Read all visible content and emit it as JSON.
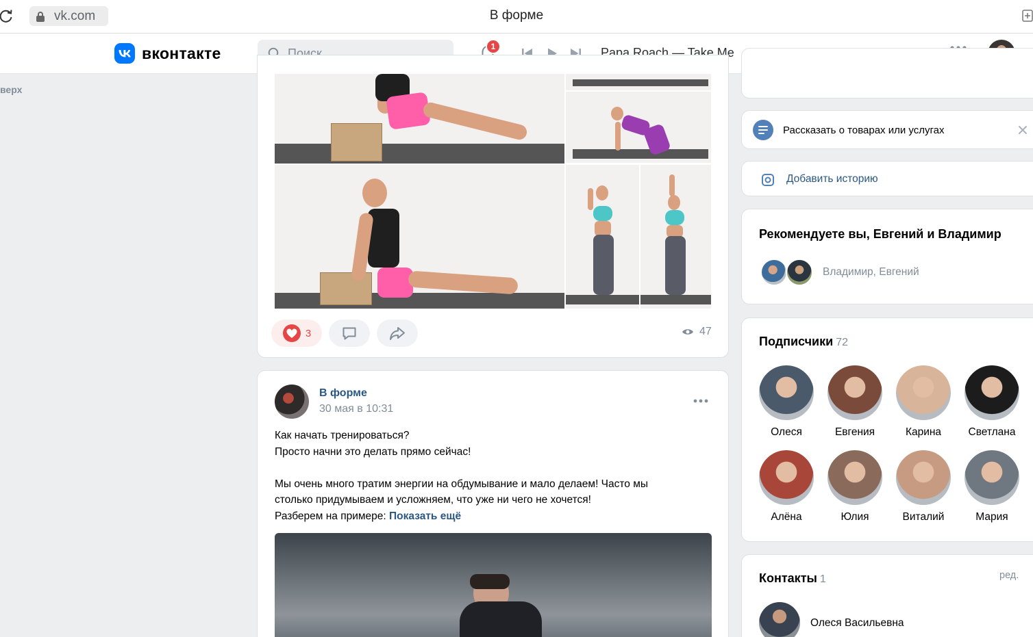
{
  "browser": {
    "url": "vk.com",
    "tab_title": "В форме"
  },
  "header": {
    "logo_text": "вконтакте",
    "search_placeholder": "Поиск",
    "notifications_badge": "1",
    "now_playing": "Papa Roach — Take Me"
  },
  "left": {
    "to_top_label": "верх"
  },
  "post1": {
    "likes": "3",
    "views": "47"
  },
  "post2": {
    "author": "В форме",
    "date": "30 мая в 10:31",
    "text_lines": [
      "Как начать тренироваться?",
      "Просто начни это делать прямо сейчас!",
      "",
      "Мы очень много тратим энергии на обдумывание и мало делаем! Часто мы",
      "столько придумываем и усложняем, что уже ни чего не хочется!",
      "Разберем на примере:"
    ],
    "show_more": "Показать ещё"
  },
  "right": {
    "goods_prompt": "Рассказать о товарах или услугах",
    "add_story": "Добавить историю",
    "recommend_title": "Рекомендуете вы, Евгений и Владимир",
    "recommend_names": "Владимир, Евгений",
    "subscribers_title": "Подписчики",
    "subscribers_count": "72",
    "subscribers": [
      {
        "name": "Олеся",
        "color": "#4a5a6a"
      },
      {
        "name": "Евгения",
        "color": "#7a4a3a"
      },
      {
        "name": "Карина",
        "color": "#d8b49a"
      },
      {
        "name": "Светлана",
        "color": "#1c1c1c"
      },
      {
        "name": "Алёна",
        "color": "#a8463a"
      },
      {
        "name": "Юлия",
        "color": "#8a6a5a"
      },
      {
        "name": "Виталий",
        "color": "#c79a82"
      },
      {
        "name": "Мария",
        "color": "#6f7780"
      }
    ],
    "contacts_title": "Контакты",
    "contacts_count": "1",
    "contacts_edit": "ред.",
    "contact_name": "Олеся Васильевна"
  },
  "colors": {
    "vk_blue": "#0077ff",
    "link": "#2a5885",
    "like_red": "#e64646",
    "secondary_text": "#818c99"
  }
}
